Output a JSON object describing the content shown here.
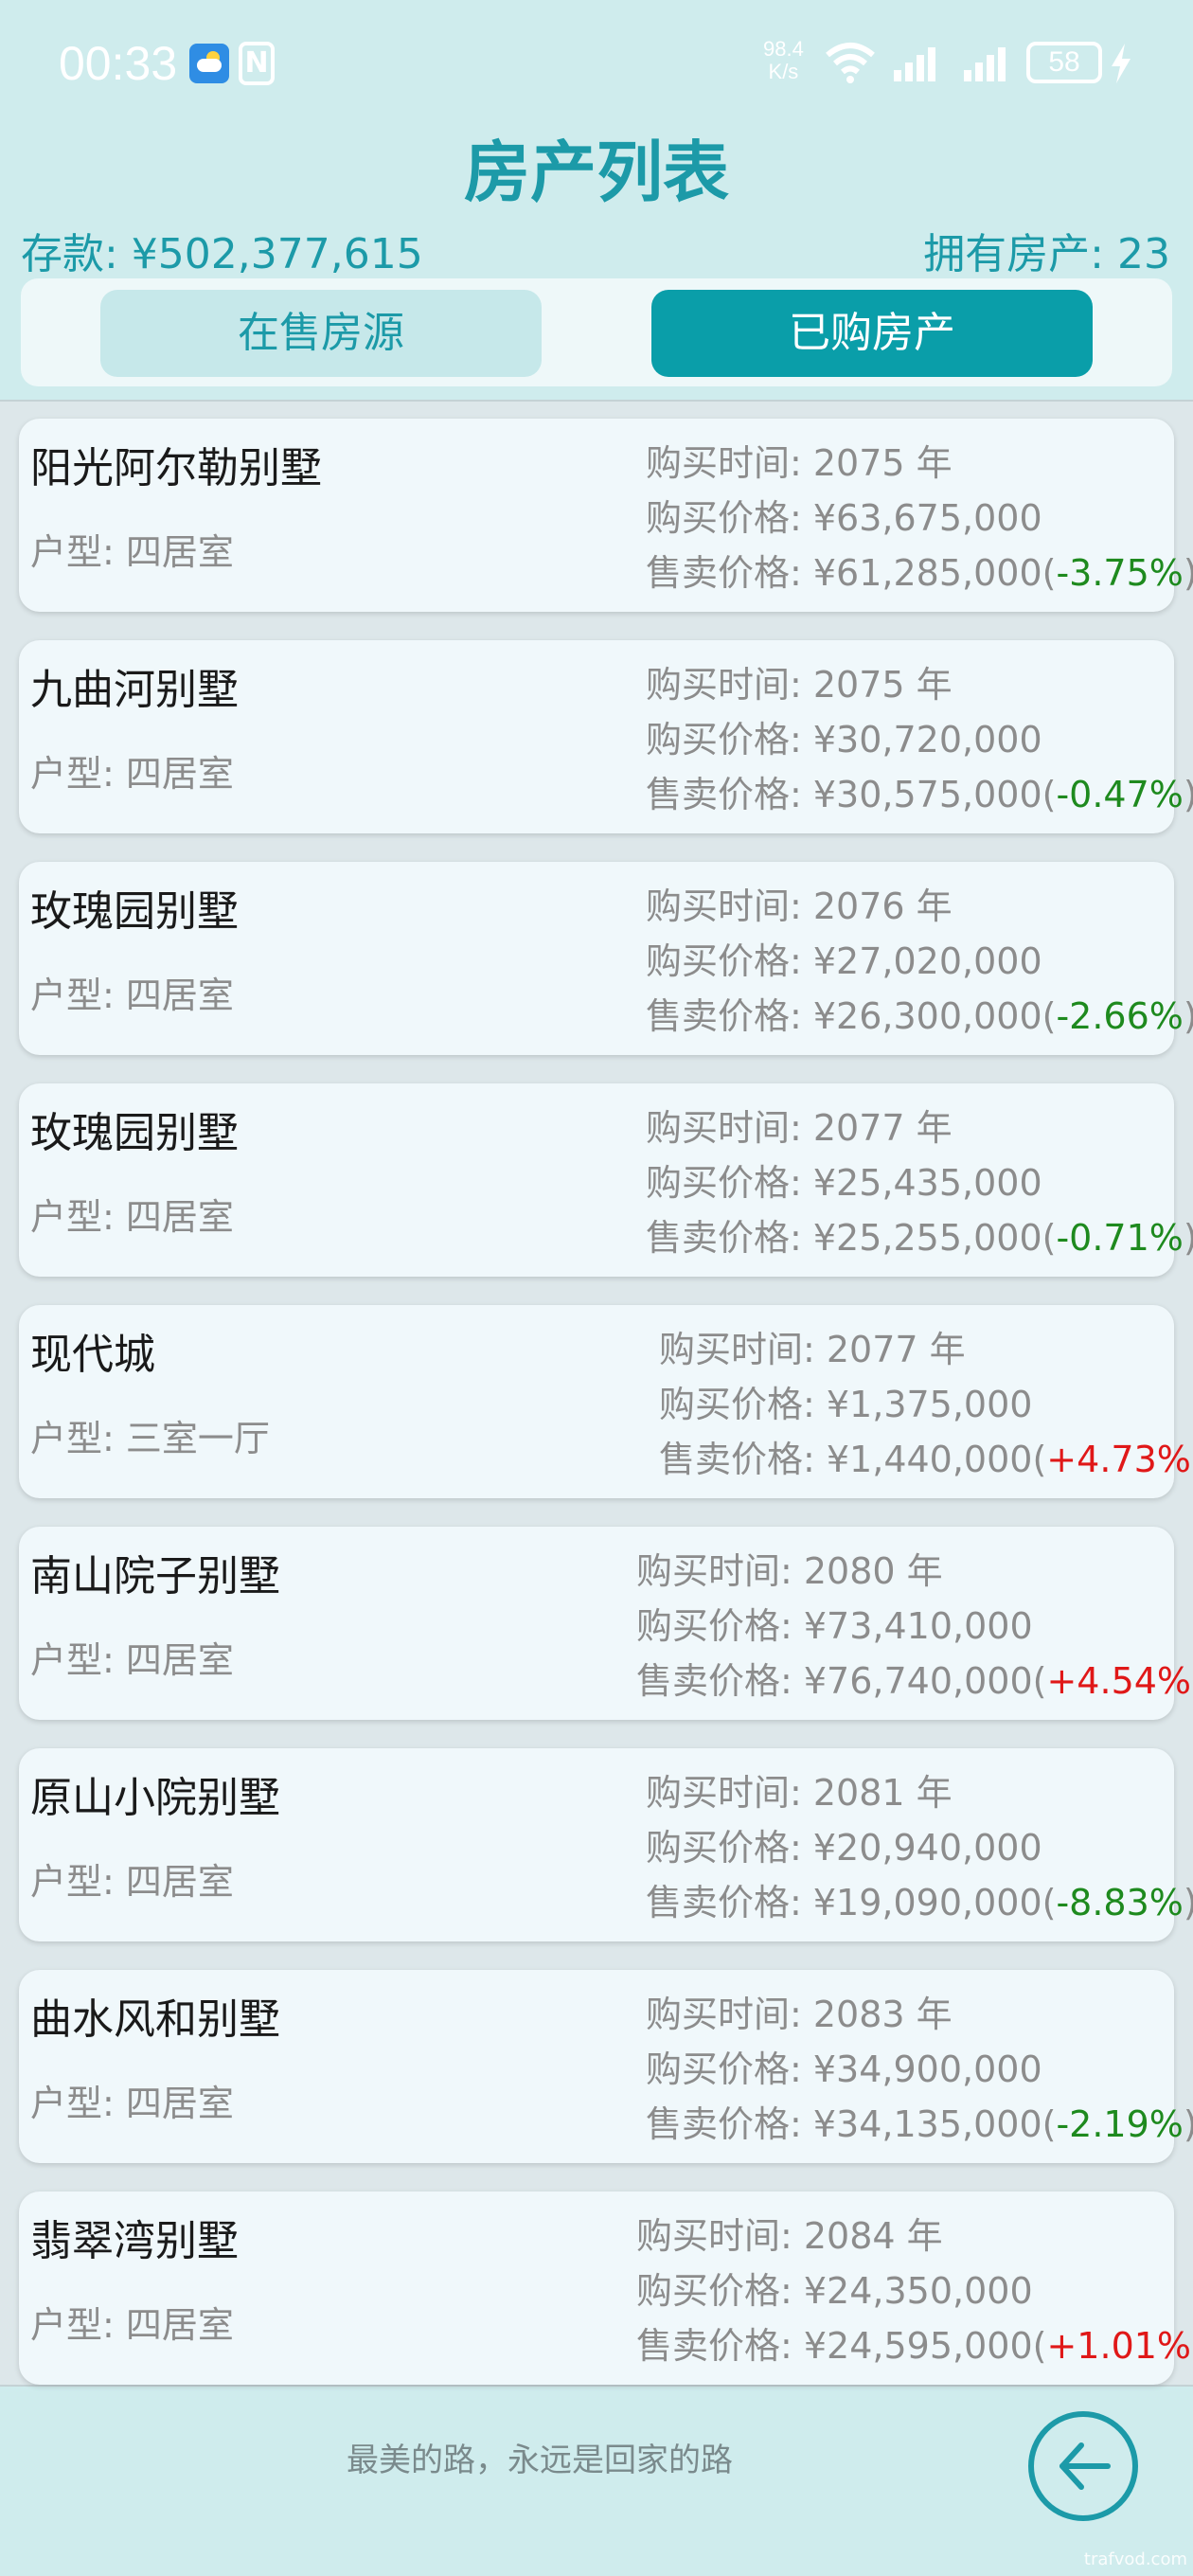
{
  "status_bar": {
    "time": "00:33",
    "net_speed_value": "98.4",
    "net_speed_unit": "K/s",
    "battery": "58",
    "icons": [
      "weather-icon",
      "nfc-icon",
      "wifi-icon",
      "signal-icon",
      "signal-icon",
      "battery-icon",
      "charging-icon"
    ]
  },
  "header": {
    "title": "房产列表",
    "savings": "存款: ¥502,377,615",
    "owned_count": "拥有房产: 23"
  },
  "tabs": [
    {
      "label": "在售房源",
      "active": false
    },
    {
      "label": "已购房产",
      "active": true
    }
  ],
  "properties": [
    {
      "name": "阳光阿尔勒别墅",
      "type": "户型: 四居室",
      "buy_time": "购买时间: 2075 年",
      "buy_price": "购买价格: ¥63,675,000",
      "sell_price": "售卖价格: ¥61,285,000",
      "change": "-3.75%",
      "direction": "down"
    },
    {
      "name": "九曲河别墅",
      "type": "户型: 四居室",
      "buy_time": "购买时间: 2075 年",
      "buy_price": "购买价格: ¥30,720,000",
      "sell_price": "售卖价格: ¥30,575,000",
      "change": "-0.47%",
      "direction": "down"
    },
    {
      "name": "玫瑰园别墅",
      "type": "户型: 四居室",
      "buy_time": "购买时间: 2076 年",
      "buy_price": "购买价格: ¥27,020,000",
      "sell_price": "售卖价格: ¥26,300,000",
      "change": "-2.66%",
      "direction": "down"
    },
    {
      "name": "玫瑰园别墅",
      "type": "户型: 四居室",
      "buy_time": "购买时间: 2077 年",
      "buy_price": "购买价格: ¥25,435,000",
      "sell_price": "售卖价格: ¥25,255,000",
      "change": "-0.71%",
      "direction": "down"
    },
    {
      "name": "现代城",
      "type": "户型: 三室一厅",
      "buy_time": "购买时间: 2077 年",
      "buy_price": "购买价格: ¥1,375,000",
      "sell_price": "售卖价格: ¥1,440,000",
      "change": "+4.73%",
      "direction": "up"
    },
    {
      "name": "南山院子别墅",
      "type": "户型: 四居室",
      "buy_time": "购买时间: 2080 年",
      "buy_price": "购买价格: ¥73,410,000",
      "sell_price": "售卖价格: ¥76,740,000",
      "change": "+4.54%",
      "direction": "up"
    },
    {
      "name": "原山小院别墅",
      "type": "户型: 四居室",
      "buy_time": "购买时间: 2081 年",
      "buy_price": "购买价格: ¥20,940,000",
      "sell_price": "售卖价格: ¥19,090,000",
      "change": "-8.83%",
      "direction": "down"
    },
    {
      "name": "曲水风和别墅",
      "type": "户型: 四居室",
      "buy_time": "购买时间: 2083 年",
      "buy_price": "购买价格: ¥34,900,000",
      "sell_price": "售卖价格: ¥34,135,000",
      "change": "-2.19%",
      "direction": "down"
    },
    {
      "name": "翡翠湾别墅",
      "type": "户型: 四居室",
      "buy_time": "购买时间: 2084 年",
      "buy_price": "购买价格: ¥24,350,000",
      "sell_price": "售卖价格: ¥24,595,000",
      "change": "+1.01%",
      "direction": "up"
    }
  ],
  "footer": {
    "motto": "最美的路，永远是回家的路",
    "back_icon": "arrow-left-icon",
    "watermark": "trafvod.com"
  },
  "colors": {
    "background": "#cfeced",
    "accent": "#1c9aa8",
    "active_tab": "#0a9ea9",
    "down": "#1e8a1e",
    "up": "#e01818"
  }
}
